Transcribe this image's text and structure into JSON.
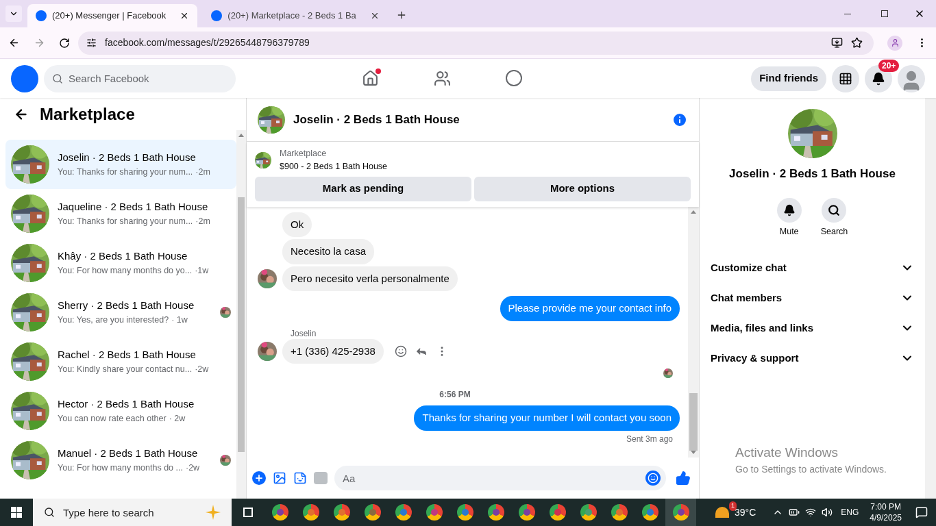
{
  "browser": {
    "tabs": [
      {
        "title": "(20+) Messenger | Facebook",
        "selected": true
      },
      {
        "title": "(20+) Marketplace - 2 Beds 1 Ba",
        "selected": false
      }
    ],
    "address": "facebook.com/messages/t/29265448796379789"
  },
  "header": {
    "search": {
      "placeholder": "Search Facebook"
    },
    "home_unread": true,
    "find_friends": "Find friends",
    "notification_badge": "20+"
  },
  "sidebar": {
    "title": "Marketplace",
    "conversations": [
      {
        "name": "Joselin · 2 Beds 1 Bath House",
        "preview": "You: Thanks for sharing your num...",
        "time": "·2m",
        "selected": true,
        "seen_avatar": false
      },
      {
        "name": "Jaqueline · 2 Beds 1 Bath House",
        "preview": "You: Thanks for sharing your num...",
        "time": "·2m",
        "selected": false,
        "seen_avatar": false
      },
      {
        "name": "Khây · 2 Beds 1 Bath House",
        "preview": "You: For how many months do yo...",
        "time": "·1w",
        "selected": false,
        "seen_avatar": false
      },
      {
        "name": "Sherry · 2 Beds 1 Bath House",
        "preview": "You: Yes, are you interested?",
        "time": "· 1w",
        "selected": false,
        "seen_avatar": true
      },
      {
        "name": "Rachel · 2 Beds 1 Bath House",
        "preview": "You: Kindly share your contact nu...",
        "time": "·2w",
        "selected": false,
        "seen_avatar": false
      },
      {
        "name": "Hector · 2 Beds 1 Bath House",
        "preview": "You can now rate each other",
        "time": "· 2w",
        "selected": false,
        "seen_avatar": false
      },
      {
        "name": "Manuel · 2 Beds 1 Bath House",
        "preview": "You: For how many months do ...",
        "time": "·2w",
        "selected": false,
        "seen_avatar": true
      }
    ]
  },
  "chat": {
    "title": "Joselin · 2 Beds 1 Bath House",
    "listing": {
      "source": "Marketplace",
      "title": "$900 - 2 Beds 1 Bath House"
    },
    "buttons": [
      "Mark as pending",
      "More options"
    ],
    "messages": [
      {
        "kind": "incoming",
        "text": "Ok",
        "avatar": false,
        "actions": false
      },
      {
        "kind": "incoming",
        "text": "Necesito la casa",
        "avatar": false,
        "actions": false
      },
      {
        "kind": "incoming",
        "text": "Pero necesito verla personalmente",
        "avatar": true,
        "actions": false
      },
      {
        "kind": "outgoing",
        "text": "Please provide me your contact info"
      },
      {
        "kind": "sender",
        "text": "Joselin"
      },
      {
        "kind": "incoming",
        "text": "+1 (336) 425-2938",
        "avatar": true,
        "actions": true
      },
      {
        "kind": "seen"
      },
      {
        "kind": "timestamp",
        "text": "6:56 PM"
      },
      {
        "kind": "outgoing",
        "text": "Thanks for sharing your number I will contact you soon"
      },
      {
        "kind": "status",
        "text": "Sent 3m ago"
      }
    ],
    "composer": {
      "placeholder": "Aa"
    }
  },
  "details": {
    "name": "Joselin · 2 Beds 1 Bath House",
    "actions": [
      {
        "label": "Mute",
        "kind": "bell"
      },
      {
        "label": "Search",
        "kind": "search"
      }
    ],
    "sections": [
      {
        "label": "Customize chat",
        "expanded": false
      },
      {
        "label": "Chat members",
        "expanded": false
      },
      {
        "label": "Media, files and links",
        "expanded": false
      },
      {
        "label": "Privacy & support",
        "expanded": false
      }
    ]
  },
  "activation": {
    "title": "Activate Windows",
    "text": "Go to Settings to activate Windows."
  },
  "taskbar": {
    "search": {
      "placeholder": "Type here to search"
    },
    "apps": [
      {
        "color": "#7b3fa0"
      },
      {
        "color": "#e07030"
      },
      {
        "color": "#e07030"
      },
      {
        "color": "#8a6a40"
      },
      {
        "color": "#2a7ad0"
      },
      {
        "color": "#c03a80"
      },
      {
        "color": "#2a7ad0"
      },
      {
        "color": "#7b3fa0"
      },
      {
        "color": "#7b3fa0"
      },
      {
        "color": "#d03050"
      },
      {
        "color": "#4aa070"
      },
      {
        "color": "#e07030"
      },
      {
        "color": "#2a7ad0"
      },
      {
        "color": "#7b3fa0"
      }
    ],
    "weather_badge": "1",
    "temperature": "39°C",
    "language": "ENG",
    "time": "7:00 PM",
    "date": "4/9/2025"
  }
}
